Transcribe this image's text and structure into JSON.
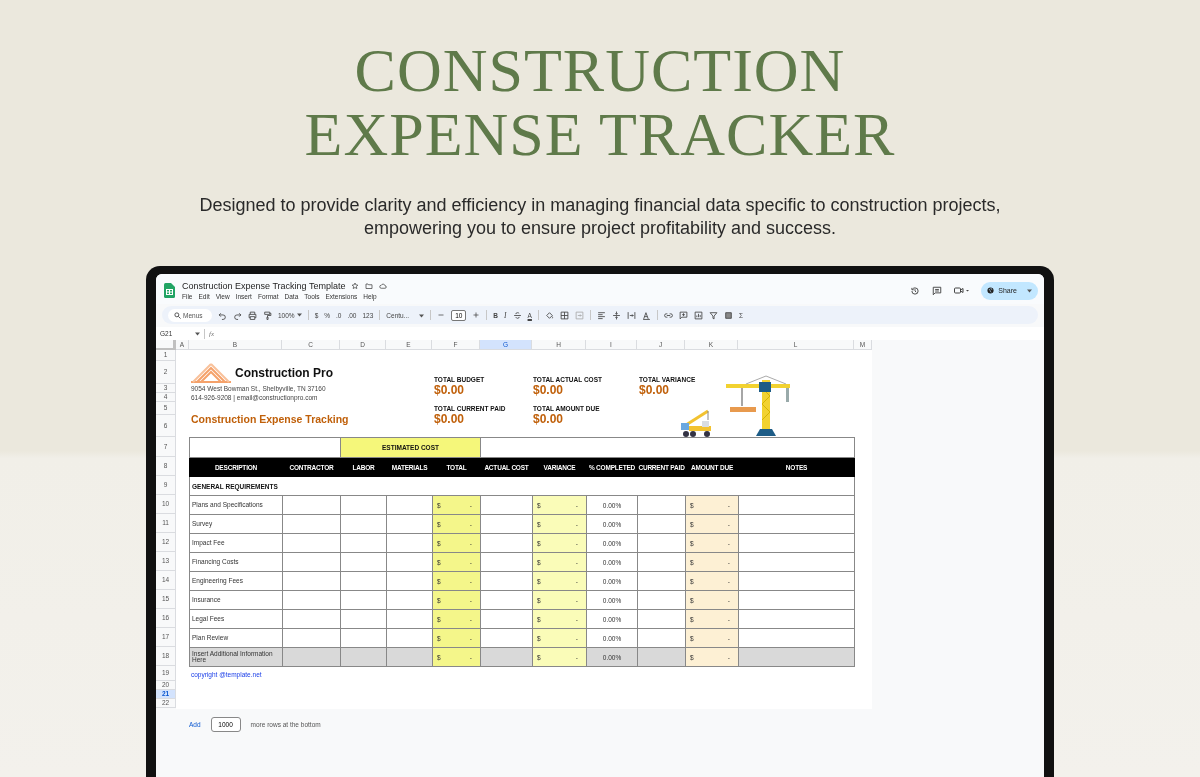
{
  "hero": {
    "title_lines": [
      "CONSTRUCTION",
      "EXPENSE TRACKER"
    ],
    "subtitle": "Designed to provide clarity and efficiency in managing financial data specific to construction projects, empowering you to ensure project profitability and success."
  },
  "app": {
    "doc_title": "Construction Expense Tracking Template",
    "menu": [
      "File",
      "Edit",
      "View",
      "Insert",
      "Format",
      "Data",
      "Tools",
      "Extensions",
      "Help"
    ],
    "share": "Share",
    "toolbar": {
      "search_placeholder": "Menus",
      "zoom": "100%",
      "number_formats": [
        "$",
        "%",
        ".0",
        ".00",
        "123"
      ],
      "font": "Centu...",
      "font_size": "10",
      "text_styles": [
        "B",
        "I",
        "A"
      ],
      "sum": "Σ"
    },
    "name_box": "G21",
    "formula_label": "fx",
    "columns": [
      {
        "label": "A",
        "selected": false
      },
      {
        "label": "B",
        "selected": false
      },
      {
        "label": "C",
        "selected": false
      },
      {
        "label": "D",
        "selected": false
      },
      {
        "label": "E",
        "selected": false
      },
      {
        "label": "F",
        "selected": false
      },
      {
        "label": "G",
        "selected": true
      },
      {
        "label": "H",
        "selected": false
      },
      {
        "label": "I",
        "selected": false
      },
      {
        "label": "J",
        "selected": false
      },
      {
        "label": "K",
        "selected": false
      },
      {
        "label": "L",
        "selected": false
      },
      {
        "label": "M",
        "selected": false
      }
    ],
    "row_numbers": [
      {
        "label": "1",
        "selected": false
      },
      {
        "label": "2",
        "selected": false
      },
      {
        "label": "3",
        "selected": false
      },
      {
        "label": "4",
        "selected": false
      },
      {
        "label": "5",
        "selected": false
      },
      {
        "label": "6",
        "selected": false
      },
      {
        "label": "7",
        "selected": false
      },
      {
        "label": "8",
        "selected": false
      },
      {
        "label": "9",
        "selected": false
      },
      {
        "label": "10",
        "selected": false
      },
      {
        "label": "11",
        "selected": false
      },
      {
        "label": "12",
        "selected": false
      },
      {
        "label": "13",
        "selected": false
      },
      {
        "label": "14",
        "selected": false
      },
      {
        "label": "15",
        "selected": false
      },
      {
        "label": "16",
        "selected": false
      },
      {
        "label": "17",
        "selected": false
      },
      {
        "label": "18",
        "selected": false
      },
      {
        "label": "19",
        "selected": false
      },
      {
        "label": "20",
        "selected": false
      },
      {
        "label": "21",
        "selected": true
      },
      {
        "label": "22",
        "selected": false
      }
    ],
    "sheet": {
      "company": "Construction Pro",
      "address": "9054 West Bowman St., Shelbyville, TN 37160",
      "contact": "614-926-9208  | email@constructionpro.com",
      "heading": "Construction Expense Tracking",
      "totals": [
        {
          "label": "TOTAL BUDGET",
          "value": "$0.00"
        },
        {
          "label": "TOTAL ACTUAL COST",
          "value": "$0.00"
        },
        {
          "label": "TOTAL VARIANCE",
          "value": "$0.00"
        },
        {
          "label": "TOTAL CURRENT PAID",
          "value": "$0.00"
        },
        {
          "label": "TOTAL AMOUNT DUE",
          "value": "$0.00"
        }
      ],
      "group_header": "ESTIMATED COST",
      "columns": [
        "DESCRIPTION",
        "CONTRACTOR",
        "LABOR",
        "MATERIALS",
        "TOTAL",
        "ACTUAL COST",
        "VARIANCE",
        "% COMPLETED",
        "CURRENT PAID",
        "AMOUNT DUE",
        "NOTES"
      ],
      "section": "GENERAL REQUIREMENTS",
      "rows": [
        {
          "description": "Plans and Specifications",
          "shaded": false,
          "total": [
            "$",
            "-"
          ],
          "variance": [
            "$",
            "-"
          ],
          "completed": "0.00%",
          "amount_due": [
            "$",
            "-"
          ]
        },
        {
          "description": "Survey",
          "shaded": false,
          "total": [
            "$",
            "-"
          ],
          "variance": [
            "$",
            "-"
          ],
          "completed": "0.00%",
          "amount_due": [
            "$",
            "-"
          ]
        },
        {
          "description": "Impact Fee",
          "shaded": false,
          "total": [
            "$",
            "-"
          ],
          "variance": [
            "$",
            "-"
          ],
          "completed": "0.00%",
          "amount_due": [
            "$",
            "-"
          ]
        },
        {
          "description": "Financing Costs",
          "shaded": false,
          "total": [
            "$",
            "-"
          ],
          "variance": [
            "$",
            "-"
          ],
          "completed": "0.00%",
          "amount_due": [
            "$",
            "-"
          ]
        },
        {
          "description": "Engineering Fees",
          "shaded": false,
          "total": [
            "$",
            "-"
          ],
          "variance": [
            "$",
            "-"
          ],
          "completed": "0.00%",
          "amount_due": [
            "$",
            "-"
          ]
        },
        {
          "description": "Insurance",
          "shaded": false,
          "total": [
            "$",
            "-"
          ],
          "variance": [
            "$",
            "-"
          ],
          "completed": "0.00%",
          "amount_due": [
            "$",
            "-"
          ]
        },
        {
          "description": "Legal Fees",
          "shaded": false,
          "total": [
            "$",
            "-"
          ],
          "variance": [
            "$",
            "-"
          ],
          "completed": "0.00%",
          "amount_due": [
            "$",
            "-"
          ]
        },
        {
          "description": "Plan Review",
          "shaded": false,
          "total": [
            "$",
            "-"
          ],
          "variance": [
            "$",
            "-"
          ],
          "completed": "0.00%",
          "amount_due": [
            "$",
            "-"
          ]
        },
        {
          "description": "Insert Additional Information Here",
          "shaded": true,
          "total": [
            "$",
            "-"
          ],
          "variance": [
            "$",
            "-"
          ],
          "completed": "0.00%",
          "amount_due": [
            "$",
            "-"
          ]
        }
      ],
      "copyright": "copyright @template.net"
    },
    "add_rows": {
      "button": "Add",
      "count": "1000",
      "suffix": "more rows at the bottom"
    }
  }
}
